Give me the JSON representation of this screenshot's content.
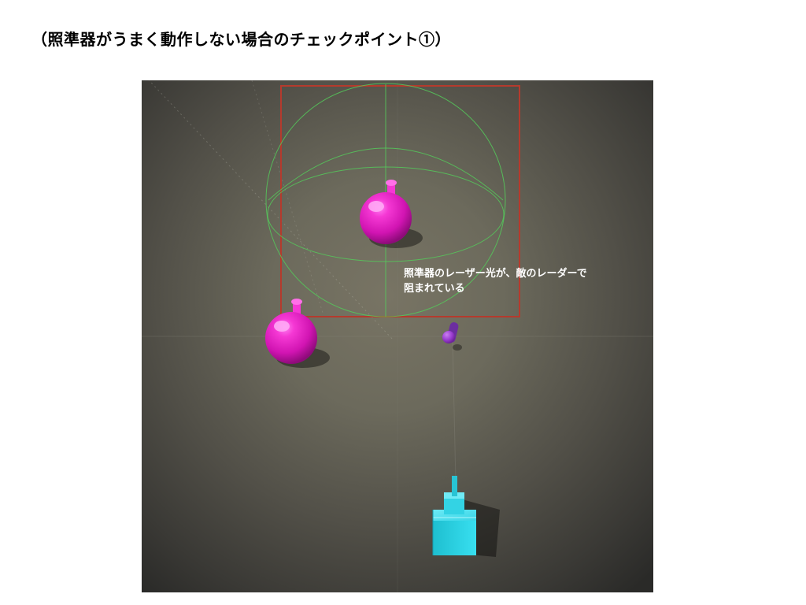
{
  "title": "（照準器がうまく動作しない場合のチェックポイント①）",
  "annotation": {
    "line1": "照準器のレーザー光が、敵のレーダーで",
    "line2": "阻まれている"
  },
  "colors": {
    "highlight_box": "#b53a2d",
    "wire_sphere": "#55c95a",
    "enemy": "#ea28c5",
    "enemy_highlight": "#ff6ff0",
    "laser_tip": "#a23fd6",
    "player": "#28d2e2",
    "player_light": "#6ee8f3",
    "shadow": "rgba(0,0,0,0.35)"
  }
}
